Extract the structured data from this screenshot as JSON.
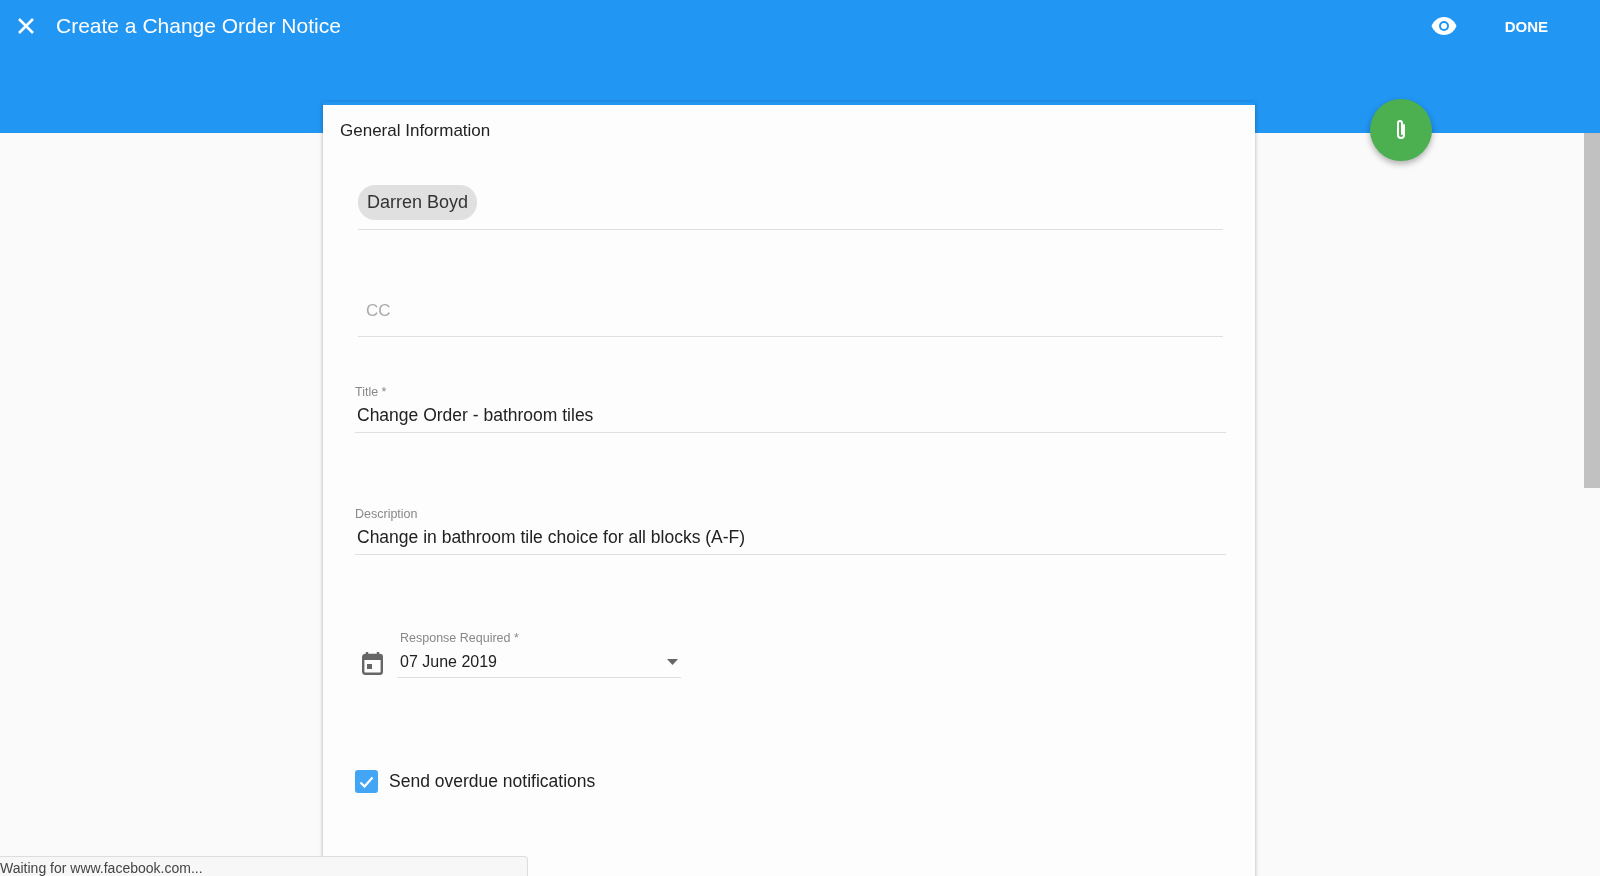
{
  "app_bar": {
    "title": "Create a Change Order Notice",
    "action": "DONE"
  },
  "card": {
    "heading": "General Information",
    "recipients": [
      {
        "name": "Darren Boyd"
      }
    ],
    "cc": {
      "placeholder": "CC"
    },
    "title_field": {
      "label": "Title *",
      "value": "Change Order - bathroom tiles"
    },
    "description_field": {
      "label": "Description",
      "value": "Change in bathroom tile choice for all blocks (A-F)"
    },
    "response_field": {
      "label": "Response Required *",
      "value": "07 June 2019"
    },
    "overdue": {
      "label": "Send overdue notifications",
      "checked": true
    }
  },
  "status_bar": {
    "text": "Waiting for www.facebook.com..."
  }
}
